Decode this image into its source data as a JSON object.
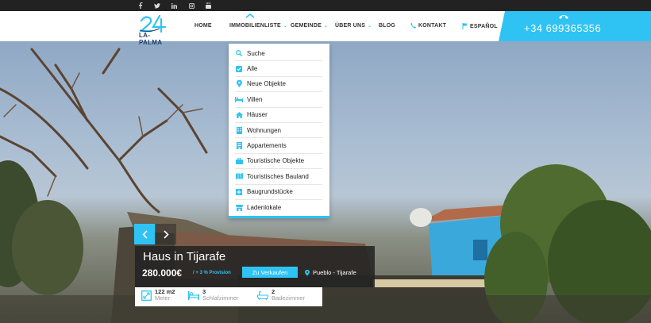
{
  "social": [
    {
      "icon": "facebook-icon"
    },
    {
      "icon": "twitter-icon"
    },
    {
      "icon": "linkedin-icon"
    },
    {
      "icon": "instagram-icon"
    },
    {
      "icon": "youtube-icon"
    }
  ],
  "logo": {
    "number": "24",
    "text": "LA-PALMA"
  },
  "nav": {
    "home": "HOME",
    "properties": "IMMOBILIENLISTE",
    "municipality": "GEMEINDE",
    "about": "ÜBER UNS",
    "blog": "BLOG",
    "contact": "KONTAKT",
    "language": "ESPAÑOL"
  },
  "phone": "+34 699365356",
  "dropdown": [
    {
      "label": "Suche",
      "icon": "search-icon"
    },
    {
      "label": "Alle",
      "icon": "checkbox-icon"
    },
    {
      "label": "Neue Objekte",
      "icon": "map-pin-icon"
    },
    {
      "label": "Villen",
      "icon": "bed-icon"
    },
    {
      "label": "Häuser",
      "icon": "home-icon"
    },
    {
      "label": "Wohnungen",
      "icon": "building-icon"
    },
    {
      "label": "Appartements",
      "icon": "apartment-icon"
    },
    {
      "label": "Touristische Objekte",
      "icon": "suitcase-icon"
    },
    {
      "label": "Touristisches Bauland",
      "icon": "map-icon"
    },
    {
      "label": "Baugrundstücke",
      "icon": "plot-icon"
    },
    {
      "label": "Ladenlokale",
      "icon": "shop-icon"
    }
  ],
  "listing": {
    "title": "Haus in Tijarafe",
    "price": "280.000€",
    "commission": "/ + 3 % Provision",
    "status": "Zu Verkaufen",
    "location": "Pueblo - Tijarafe",
    "area_value": "122 m2",
    "area_label": "Meter",
    "bedrooms_value": "3",
    "bedrooms_label": "Schlafzimmer",
    "bathrooms_value": "2",
    "bathrooms_label": "Badezimmer"
  },
  "colors": {
    "accent": "#2ec3f3",
    "dark": "#222222",
    "logo_text": "#1e3f6f"
  }
}
